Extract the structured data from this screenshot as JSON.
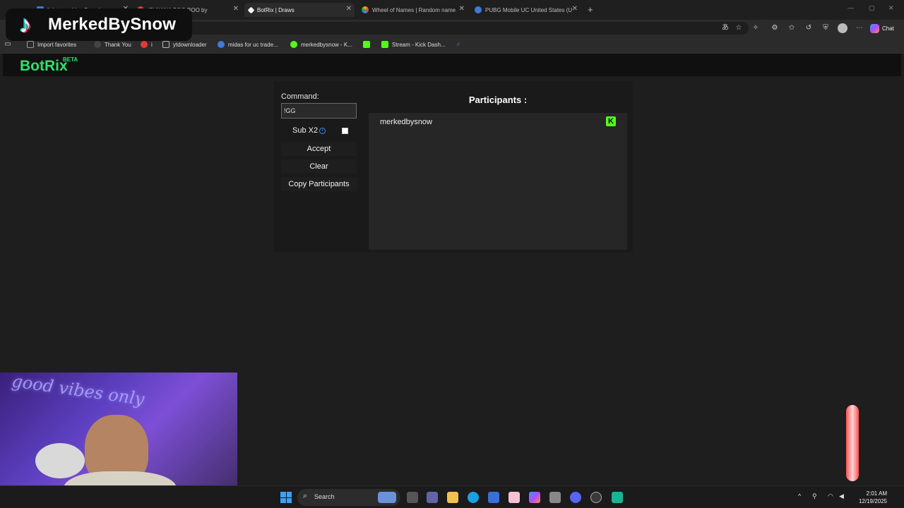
{
  "browser": {
    "tabs": [
      {
        "title": "lish to arabic - Search",
        "color": "#2f7de1"
      },
      {
        "title": "(2) NANA BOO BOO by",
        "color": "#e53935"
      },
      {
        "title": "BotRix | Draws",
        "color": "#ffffff"
      },
      {
        "title": "Wheel of Names | Random name",
        "color": "#f4b400"
      },
      {
        "title": "PUBG Mobile UC United States (U",
        "color": "#3d7bd9"
      }
    ],
    "new_tab_label": "+",
    "chat_label": "Chat",
    "favorites": [
      {
        "label": "Import favorites",
        "icon": "import-icon",
        "color": "#999999"
      },
      {
        "label": "Thank You",
        "icon": "site-icon",
        "color": "#444444"
      },
      {
        "label": "i",
        "icon": "site-icon",
        "color": "#e53935"
      },
      {
        "label": "ytdownloader",
        "icon": "folder-icon",
        "color": "#bbbbbb"
      },
      {
        "label": "midas for uc trade...",
        "icon": "site-icon",
        "color": "#3d7bd9"
      },
      {
        "label": "merkedbysnow - K...",
        "icon": "site-icon",
        "color": "#53fc18"
      },
      {
        "label": "",
        "icon": "kick-icon",
        "color": "#53fc18"
      },
      {
        "label": "Stream - Kick Dash...",
        "icon": "kick-icon",
        "color": "#53fc18"
      }
    ]
  },
  "overlay": {
    "name": "MerkedBySnow"
  },
  "site": {
    "brand": "BotRix",
    "badge": "BETA"
  },
  "draw": {
    "command_label": "Command:",
    "command_value": "!GG",
    "sub_label": "Sub X2",
    "sub_checked": false,
    "buttons": [
      "Accept",
      "Clear",
      "Copy Participants"
    ],
    "participants_title": "Participants :",
    "participants": [
      {
        "name": "merkedbysnow",
        "platform": "kick"
      }
    ]
  },
  "webcam": {
    "neon_text": "good vibes only"
  },
  "taskbar": {
    "search_label": "Search",
    "time": "2:01 AM",
    "date": "12/19/2025"
  }
}
